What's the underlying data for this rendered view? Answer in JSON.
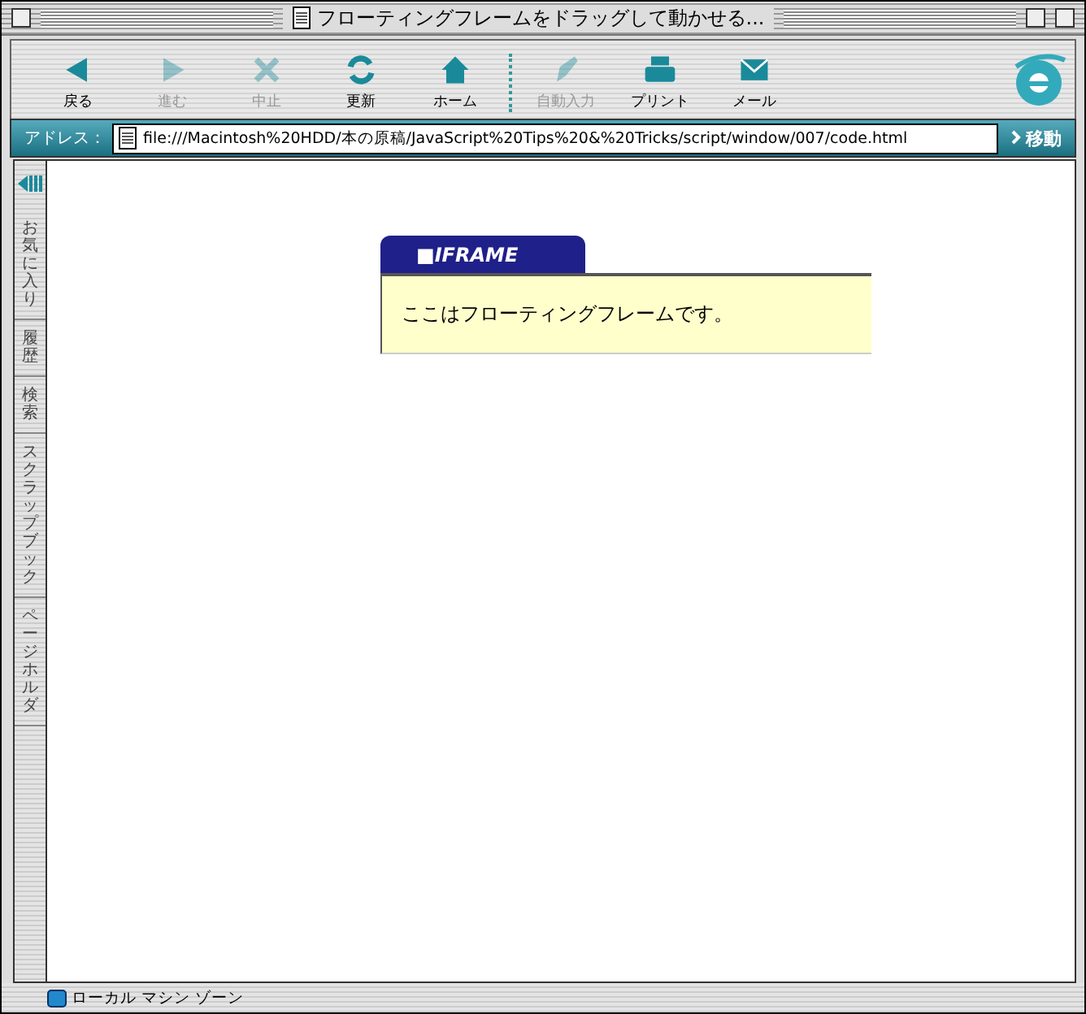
{
  "window": {
    "title": "フローティングフレームをドラッグして動かせる..."
  },
  "toolbar": {
    "buttons": [
      {
        "kind": "back",
        "label": "戻る",
        "disabled": false
      },
      {
        "kind": "forward",
        "label": "進む",
        "disabled": true
      },
      {
        "kind": "stop",
        "label": "中止",
        "disabled": true
      },
      {
        "kind": "refresh",
        "label": "更新",
        "disabled": false
      },
      {
        "kind": "home",
        "label": "ホーム",
        "disabled": false
      },
      {
        "kind": "autofill",
        "label": "自動入力",
        "disabled": true
      },
      {
        "kind": "print",
        "label": "プリント",
        "disabled": false
      },
      {
        "kind": "mail",
        "label": "メール",
        "disabled": false
      }
    ]
  },
  "address_bar": {
    "label": "アドレス：",
    "value": "file:///Macintosh%20HDD/本の原稿/JavaScript%20Tips%20&%20Tricks/script/window/007/code.html",
    "go_button": "移動"
  },
  "sidebar": {
    "tabs": [
      "お気に入り",
      "履歴",
      "検索",
      "スクラップブック",
      "ページホルダ"
    ]
  },
  "floating_frame": {
    "tab": "■IFRAME",
    "text": "ここはフローティングフレームです。"
  },
  "status_bar": {
    "zone": "ローカル マシン ゾーン"
  }
}
